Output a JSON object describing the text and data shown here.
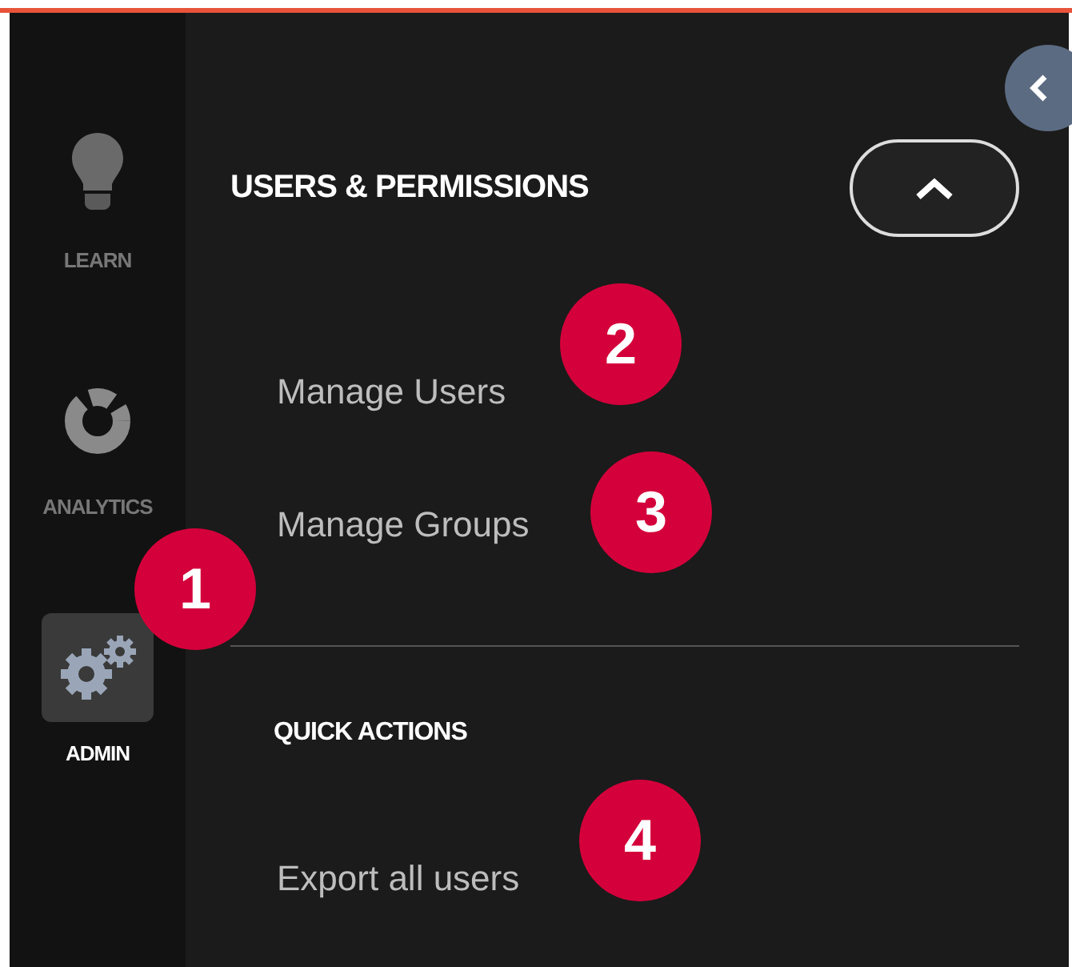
{
  "rail": {
    "items": [
      {
        "label": "LEARN",
        "kind": "bulb",
        "selected": false
      },
      {
        "label": "ANALYTICS",
        "kind": "ring",
        "selected": false
      },
      {
        "label": "ADMIN",
        "kind": "gears",
        "selected": true
      }
    ]
  },
  "sections": [
    {
      "title": "USERS & PERMISSIONS",
      "expanded": true,
      "items": [
        "Manage Users",
        "Manage Groups"
      ]
    },
    {
      "title": "QUICK ACTIONS",
      "items": [
        "Export all users"
      ]
    }
  ],
  "callouts": [
    "1",
    "2",
    "3",
    "4"
  ]
}
